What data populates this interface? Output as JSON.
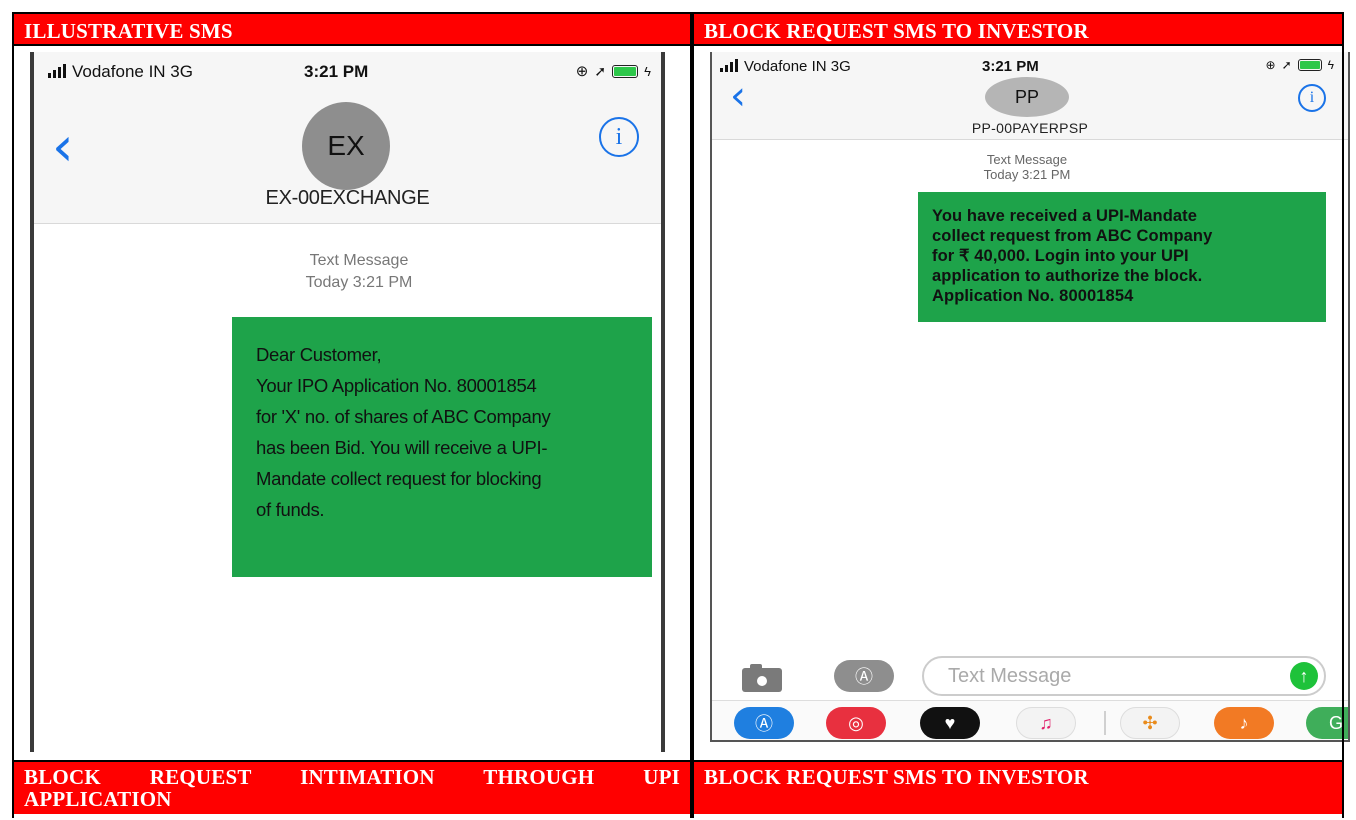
{
  "headers": {
    "top_left": "ILLUSTRATIVE SMS",
    "top_right": "BLOCK REQUEST SMS TO INVESTOR",
    "bottom_left_line1": "BLOCK REQUEST INTIMATION THROUGH UPI",
    "bottom_left_line2": "APPLICATION",
    "bottom_right": "BLOCK REQUEST SMS TO INVESTOR"
  },
  "colors": {
    "header_bg": "#ff0000",
    "bubble_green": "#1ea34a",
    "ios_blue": "#1a73e8"
  },
  "phone1": {
    "carrier": "Vodafone IN  3G",
    "time": "3:21 PM",
    "avatar": "EX",
    "contact": "EX-00EXCHANGE",
    "meta_line1": "Text Message",
    "meta_line2": "Today 3:21 PM",
    "message": "Dear Customer,\nYour IPO Application No. 80001854\nfor 'X' no. of shares of ABC Company\nhas been Bid. You will receive a UPI-\nMandate collect request for blocking\nof funds.",
    "icons": [
      "back-chevron-icon",
      "info-icon",
      "signal-icon",
      "location-icon",
      "battery-icon"
    ]
  },
  "phone2": {
    "carrier": "Vodafone IN  3G",
    "time": "3:21 PM",
    "avatar": "PP",
    "contact": "PP-00PAYERPSP",
    "meta_line1": "Text Message",
    "meta_line2": "Today 3:21 PM",
    "message": "You have received a UPI-Mandate\ncollect request from ABC Company\nfor ₹ 40,000. Login into your UPI\napplication to authorize the block.\nApplication No. 80001854",
    "composer_placeholder": "Text Message",
    "icons": [
      "back-chevron-icon",
      "info-icon",
      "camera-icon",
      "app-store-icon",
      "send-arrow-icon"
    ],
    "app_drawer": [
      "app-store-icon",
      "web-search-icon",
      "heart-icon",
      "music-icon",
      "photos-icon",
      "garageband-icon",
      "maps-icon"
    ]
  }
}
